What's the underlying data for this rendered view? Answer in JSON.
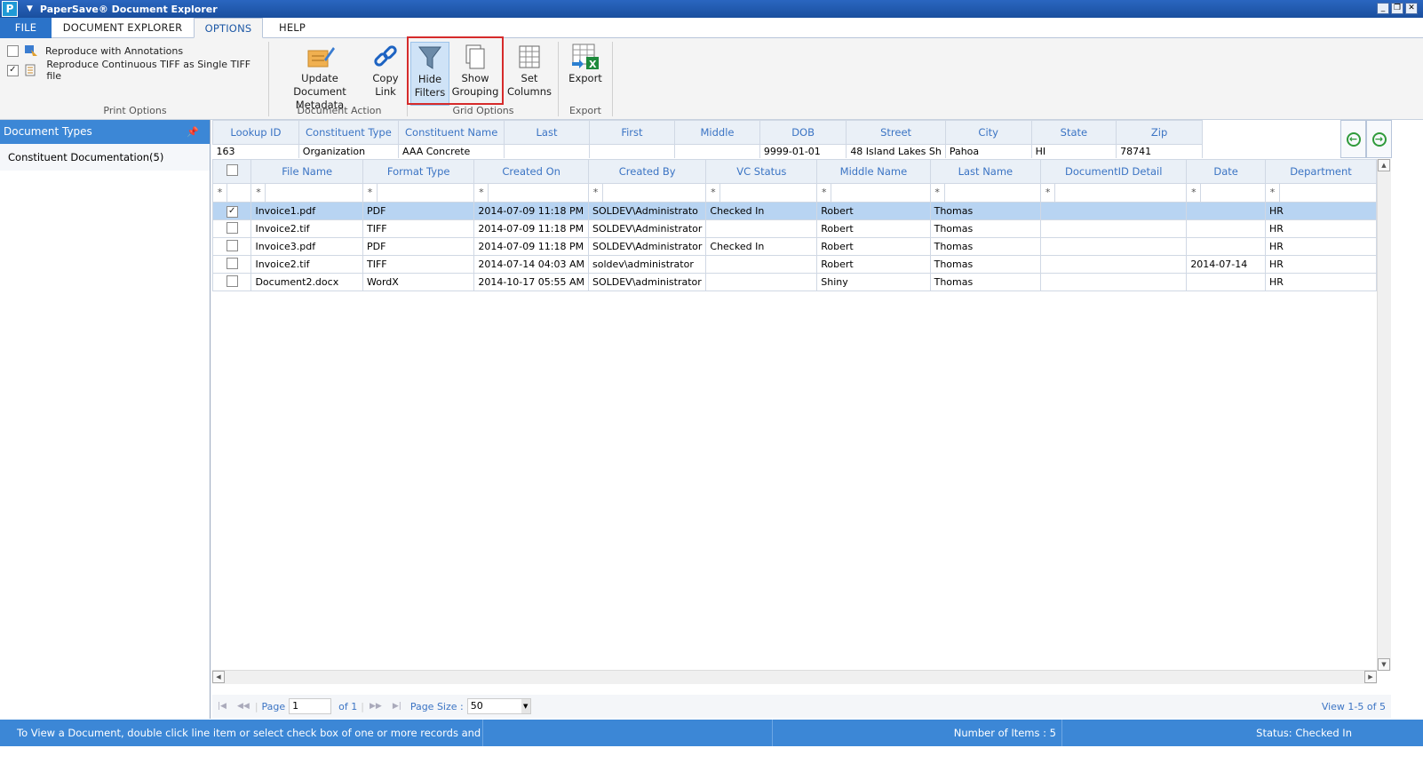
{
  "app": {
    "logo_letter": "P",
    "title": "PaperSave® Document Explorer"
  },
  "window_controls": [
    "_",
    "❐",
    "✕"
  ],
  "tabs": [
    "FILE",
    "DOCUMENT EXPLORER",
    "OPTIONS",
    "HELP"
  ],
  "ribbon": {
    "print_options": {
      "label": "Print Options",
      "reproduce_annotations": {
        "label": "Reproduce with Annotations",
        "checked": false
      },
      "reproduce_tiff": {
        "label": "Reproduce Continuous TIFF as Single TIFF file",
        "checked": true
      }
    },
    "document_action": {
      "label": "Document Action",
      "update_metadata": [
        "Update Document",
        "Metadata"
      ],
      "copy_link": [
        "Copy",
        "Link"
      ]
    },
    "grid_options": {
      "label": "Grid Options",
      "hide_filters": [
        "Hide",
        "Filters"
      ],
      "show_grouping": [
        "Show",
        "Grouping"
      ],
      "set_columns": [
        "Set",
        "Columns"
      ]
    },
    "export": {
      "label": "Export",
      "export_button": "Export"
    }
  },
  "sidebar": {
    "header": "Document Types",
    "pin_icon": "pin-icon",
    "items": [
      "Constituent Documentation(5)"
    ]
  },
  "lookup": {
    "headers": [
      "Lookup ID",
      "Constituent Type",
      "Constituent Name",
      "Last",
      "First",
      "Middle",
      "DOB",
      "Street",
      "City",
      "State",
      "Zip"
    ],
    "values": [
      "163",
      "Organization",
      "AAA Concrete",
      "",
      "",
      "",
      "9999-01-01",
      "48 Island Lakes Sh",
      "Pahoa",
      "HI",
      "78741"
    ]
  },
  "grid": {
    "headers": [
      "",
      "File Name",
      "Format Type",
      "Created On",
      "Created By",
      "VC Status",
      "Middle Name",
      "Last Name",
      "DocumentID Detail",
      "Date",
      "Department"
    ],
    "filter_star": "*",
    "rows": [
      {
        "checked": true,
        "cells": [
          "Invoice1.pdf",
          "PDF",
          "2014-07-09 11:18 PM",
          "SOLDEV\\Administrato",
          "Checked In",
          "Robert",
          "Thomas",
          "",
          "",
          "HR"
        ]
      },
      {
        "checked": false,
        "cells": [
          "Invoice2.tif",
          "TIFF",
          "2014-07-09 11:18 PM",
          "SOLDEV\\Administrator",
          "",
          "Robert",
          "Thomas",
          "",
          "",
          "HR"
        ]
      },
      {
        "checked": false,
        "cells": [
          "Invoice3.pdf",
          "PDF",
          "2014-07-09 11:18 PM",
          "SOLDEV\\Administrator",
          "Checked In",
          "Robert",
          "Thomas",
          "",
          "",
          "HR"
        ]
      },
      {
        "checked": false,
        "cells": [
          "Invoice2.tif",
          "TIFF",
          "2014-07-14 04:03 AM",
          "soldev\\administrator",
          "",
          "Robert",
          "Thomas",
          "",
          "2014-07-14",
          "HR"
        ]
      },
      {
        "checked": false,
        "cells": [
          "Document2.docx",
          "WordX",
          "2014-10-17 05:55 AM",
          "SOLDEV\\administrator",
          "",
          "Shiny",
          "Thomas",
          "",
          "",
          "HR"
        ]
      }
    ]
  },
  "pager": {
    "page_label": "Page",
    "page_value": "1",
    "of_label": "of 1",
    "page_size_label": "Page Size :",
    "page_size_value": "50",
    "view_label": "View 1-5 of 5"
  },
  "status": {
    "hint": "To View a Document, double click line item or select check box of one or more records and 'Open...",
    "items_count": "Number of Items : 5",
    "status_text": "Status: Checked In"
  },
  "colors": {
    "accent": "#3c87d6",
    "header_text": "#3b74c4",
    "selected_row": "#b8d4f2",
    "highlight_border": "#d62b2b"
  }
}
